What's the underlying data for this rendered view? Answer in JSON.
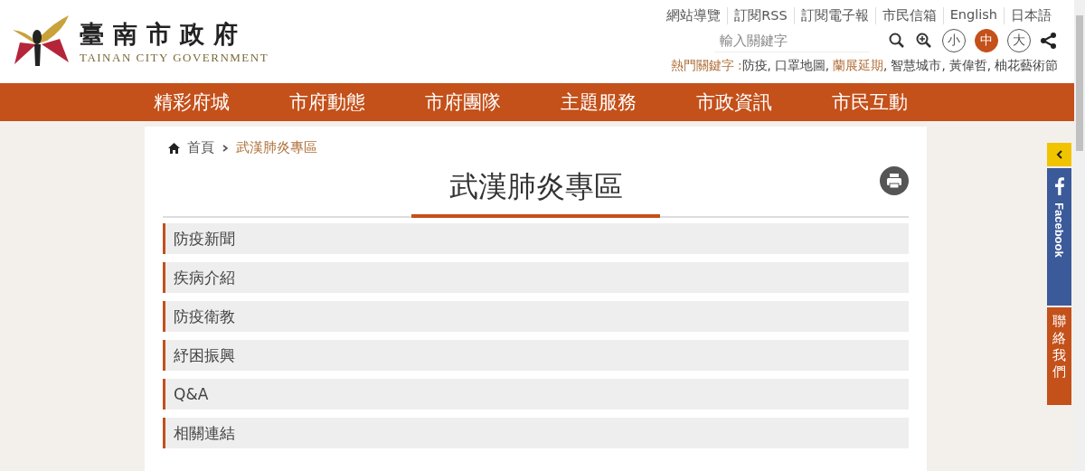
{
  "logo": {
    "title": "臺南市政府",
    "subtitle": "TAINAN CITY GOVERNMENT"
  },
  "top_links": [
    "網站導覽",
    "訂閱RSS",
    "訂閱電子報",
    "市民信箱",
    "English",
    "日本語"
  ],
  "search": {
    "placeholder": "輸入關鍵字"
  },
  "font_sizes": [
    {
      "label": "小",
      "selected": false
    },
    {
      "label": "中",
      "selected": true
    },
    {
      "label": "大",
      "selected": false
    }
  ],
  "hot_keywords": {
    "label": "熱門關鍵字 :",
    "separator": ",",
    "items": [
      {
        "text": "防疫",
        "highlighted": false
      },
      {
        "text": "口罩地圖",
        "highlighted": false
      },
      {
        "text": "蘭展延期",
        "highlighted": true
      },
      {
        "text": "智慧城市",
        "highlighted": false
      },
      {
        "text": "黃偉哲",
        "highlighted": false
      },
      {
        "text": "柚花藝術節",
        "highlighted": false
      }
    ]
  },
  "nav": [
    "精彩府城",
    "市府動態",
    "市府團隊",
    "主題服務",
    "市政資訊",
    "市民互動"
  ],
  "breadcrumb": [
    "首頁",
    "武漢肺炎專區"
  ],
  "page_title": "武漢肺炎專區",
  "menu": [
    "防疫新聞",
    "疾病介紹",
    "防疫衛教",
    "紓困振興",
    "Q&A",
    "相關連結"
  ],
  "side_tabs": [
    {
      "kind": "facebook",
      "label": "Facebook"
    },
    {
      "kind": "contact",
      "label": "聯絡我們"
    }
  ]
}
